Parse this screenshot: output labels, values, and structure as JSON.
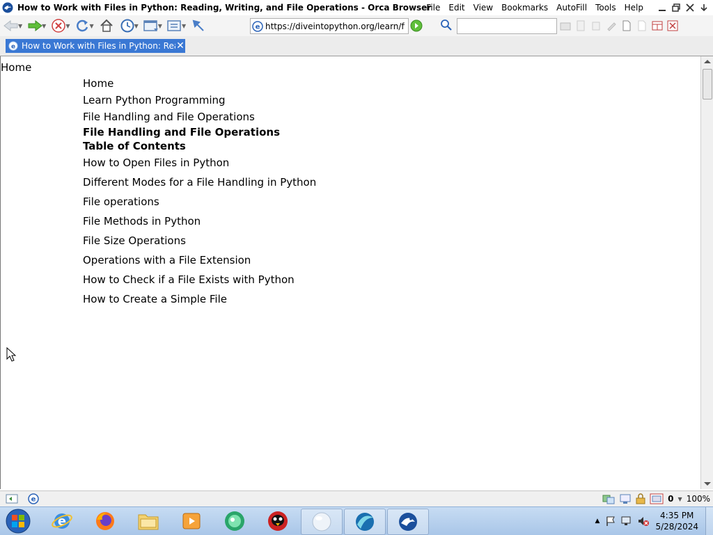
{
  "window": {
    "title": "How to Work with Files in Python: Reading, Writing, and File Operations - Orca Browser"
  },
  "menu": [
    "File",
    "Edit",
    "View",
    "Bookmarks",
    "AutoFill",
    "Tools",
    "Help"
  ],
  "toolbar": {
    "url": "https://diveintopython.org/learn/file-handling",
    "search_value": ""
  },
  "tab": {
    "label": "How to Work with Files in Python: Rea..."
  },
  "content": {
    "top_home": "Home",
    "breadcrumb": [
      "Home",
      "Learn Python Programming",
      "File Handling and File Operations"
    ],
    "heading": "File Handling and File Operations",
    "toc_title": "Table of Contents",
    "toc_items": [
      "How to Open Files in Python",
      "Different Modes for a File Handling in Python",
      "File operations",
      "File Methods in Python",
      "File Size Operations",
      "Operations with a File Extension",
      "How to Check if a File Exists with Python",
      "How to Create a Simple File"
    ]
  },
  "status": {
    "popup_count": "0",
    "zoom": "100%"
  },
  "clock": {
    "time": "4:35 PM",
    "date": "5/28/2024"
  },
  "colors": {
    "tab_active": "#3a78d4",
    "taskbar": "#b9d1ee"
  }
}
